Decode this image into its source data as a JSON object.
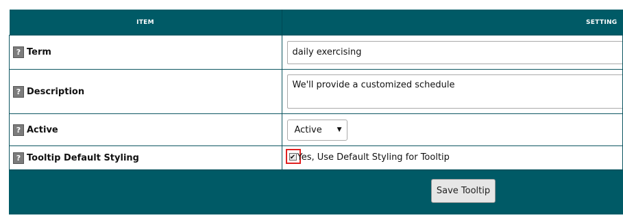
{
  "header": {
    "col_item": "ITEM",
    "col_setting": "SETTING"
  },
  "rows": [
    {
      "label": "Term",
      "help_icon": "question-mark-icon",
      "value": "daily exercising"
    },
    {
      "label": "Description",
      "help_icon": "question-mark-icon",
      "value": "We'll provide a customized schedule"
    },
    {
      "label": "Active",
      "help_icon": "question-mark-icon",
      "value": "Active"
    },
    {
      "label": "Tooltip Default Styling",
      "help_icon": "question-mark-icon",
      "value": "Yes, Use Default Styling for Tooltip",
      "checked": true
    }
  ],
  "help_glyph": "?",
  "footer": {
    "save_label": "Save Tooltip"
  },
  "colors": {
    "header_bg": "#005a66",
    "highlight": "#e02020"
  }
}
